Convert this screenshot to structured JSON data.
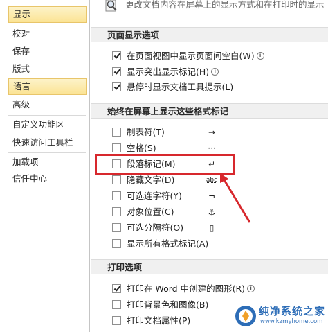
{
  "nav": {
    "items": [
      {
        "label": "显示",
        "selected": true
      },
      {
        "label": "校对",
        "selected": false
      },
      {
        "label": "保存",
        "selected": false
      },
      {
        "label": "版式",
        "selected": false
      },
      {
        "label": "语言",
        "selected": true
      },
      {
        "label": "高级",
        "selected": false
      },
      {
        "label": "自定义功能区",
        "selected": false
      },
      {
        "label": "快速访问工具栏",
        "selected": false
      },
      {
        "label": "加载项",
        "selected": false
      },
      {
        "label": "信任中心",
        "selected": false
      }
    ]
  },
  "top_description": "更改文档内容在屏幕上的显示方式和在打印时的显示",
  "sections": [
    {
      "title": "页面显示选项",
      "options": [
        {
          "label": "在页面视图中显示页面间空白(W)",
          "checked": true,
          "info": true
        },
        {
          "label": "显示突出显示标记(H)",
          "checked": true,
          "info": true
        },
        {
          "label": "悬停时显示文档工具提示(L)",
          "checked": true,
          "info": false
        }
      ]
    },
    {
      "title": "始终在屏幕上显示这些格式标记",
      "options": [
        {
          "label": "制表符(T)",
          "checked": false,
          "symbol": "→"
        },
        {
          "label": "空格(S)",
          "checked": false,
          "symbol": "···"
        },
        {
          "label": "段落标记(M)",
          "checked": false,
          "symbol": "↵"
        },
        {
          "label": "隐藏文字(D)",
          "checked": false,
          "symbol": "abc"
        },
        {
          "label": "可选连字符(Y)",
          "checked": false,
          "symbol": "¬"
        },
        {
          "label": "对象位置(C)",
          "checked": false,
          "symbol": "⚓"
        },
        {
          "label": "可选分隔符(O)",
          "checked": false,
          "symbol": "▯"
        },
        {
          "label": "显示所有格式标记(A)",
          "checked": false,
          "symbol": ""
        }
      ]
    },
    {
      "title": "打印选项",
      "options": [
        {
          "label": "打印在 Word 中创建的图形(R)",
          "checked": true,
          "info": true
        },
        {
          "label": "打印背景色和图像(B)",
          "checked": false,
          "info": false
        },
        {
          "label": "打印文档属性(P)",
          "checked": false,
          "info": false
        }
      ]
    }
  ],
  "watermark": {
    "name": "纯净系统之家",
    "url": "www.kzmyhome.com"
  },
  "colors": {
    "selected_bg": "#fbe394",
    "highlight": "#d7282d",
    "section_bg": "#f0f0f0"
  }
}
